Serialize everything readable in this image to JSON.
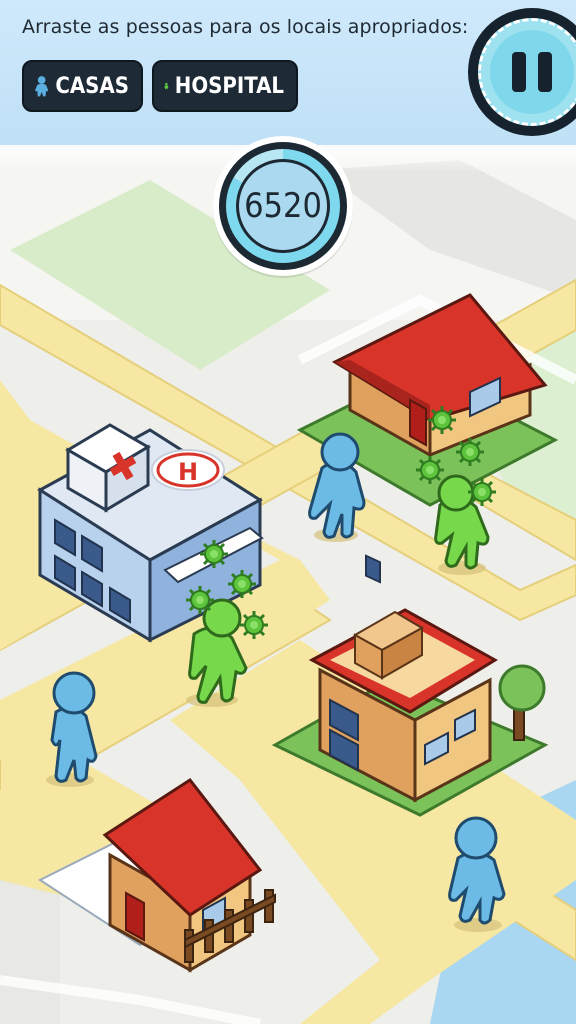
{
  "hud": {
    "instruction": "Arraste as pessoas para os locais apropriados:",
    "legend": [
      {
        "label": "CASAS",
        "icon": "blue-person-icon",
        "color": "#5aaee0"
      },
      {
        "label": "HOSPITAL",
        "icon": "green-person-icon",
        "color": "#5ed03e"
      }
    ],
    "pause_icon": "pause-icon",
    "score": "6520"
  },
  "colors": {
    "road": "#f6e7a3",
    "grass_block": "#d7ebc5",
    "roof_red": "#d8342a",
    "house_wall": "#e0a15e",
    "hospital_wall": "#b8d2ee",
    "virus": "#5ec43c",
    "healthy_person": "#6cbbe6",
    "sick_person": "#76d84a"
  },
  "scene": {
    "buildings": [
      "hospital",
      "house-top-right",
      "house-middle-right",
      "house-bottom-left"
    ],
    "people": [
      {
        "id": "blue-1",
        "status": "healthy"
      },
      {
        "id": "blue-2",
        "status": "healthy"
      },
      {
        "id": "blue-3",
        "status": "healthy"
      },
      {
        "id": "green-1",
        "status": "infected"
      },
      {
        "id": "green-2",
        "status": "infected"
      }
    ]
  }
}
